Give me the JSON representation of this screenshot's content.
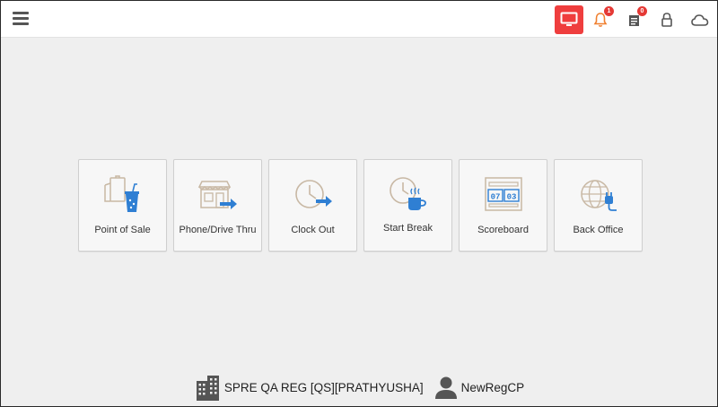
{
  "topbar": {
    "notifications_count": "1",
    "orders_count": "0"
  },
  "tiles": [
    {
      "label": "Point of Sale",
      "icon": "point-of-sale-icon"
    },
    {
      "label": "Phone/Drive Thru",
      "icon": "phone-drive-thru-icon"
    },
    {
      "label": "Clock Out",
      "icon": "clock-out-icon"
    },
    {
      "label": "Start Break",
      "icon": "start-break-icon"
    },
    {
      "label": "Scoreboard",
      "icon": "scoreboard-icon"
    },
    {
      "label": "Back Office",
      "icon": "back-office-icon"
    }
  ],
  "footer": {
    "store_name": "SPRE QA REG [QS][PRATHYUSHA]",
    "user_name": "NewRegCP"
  },
  "scoreboard_digits": {
    "left": "07",
    "right": "03"
  },
  "colors": {
    "accent_red": "#ef3e3e",
    "icon_blue": "#2f7fd3",
    "icon_tan": "#c8b8a4",
    "background": "#efefef"
  }
}
